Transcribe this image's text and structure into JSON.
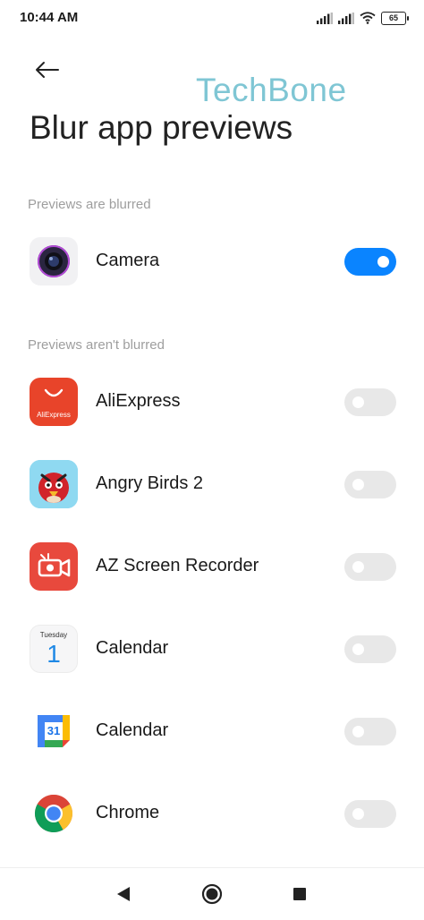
{
  "status_bar": {
    "time": "10:44 AM",
    "battery": "65",
    "icons": [
      "signal-icon",
      "signal-icon",
      "wifi-icon",
      "battery-icon"
    ]
  },
  "watermark": "TechBone",
  "header": {
    "back_icon": "back-arrow-icon",
    "title": "Blur app previews"
  },
  "sections": {
    "blurred": {
      "label": "Previews are blurred",
      "apps": [
        {
          "name": "Camera",
          "icon": "camera-icon",
          "enabled": true
        }
      ]
    },
    "not_blurred": {
      "label": "Previews aren't blurred",
      "apps": [
        {
          "name": "AliExpress",
          "icon": "aliexpress-icon",
          "icon_text": "AliExpress",
          "enabled": false
        },
        {
          "name": "Angry Birds 2",
          "icon": "angry-birds-icon",
          "enabled": false
        },
        {
          "name": "AZ Screen Recorder",
          "icon": "az-recorder-icon",
          "enabled": false
        },
        {
          "name": "Calendar",
          "icon": "calendar-icon",
          "icon_day": "Tuesday",
          "icon_date": "1",
          "enabled": false
        },
        {
          "name": "Calendar",
          "icon": "google-calendar-icon",
          "icon_date": "31",
          "enabled": false
        },
        {
          "name": "Chrome",
          "icon": "chrome-icon",
          "enabled": false
        }
      ]
    }
  },
  "navigation": {
    "back": "back-triangle-icon",
    "home": "home-circle-icon",
    "recents": "recents-square-icon"
  },
  "colors": {
    "accent": "#0a84ff",
    "toggle_off": "#e8e8e8",
    "section_label": "#9e9e9e",
    "watermark": "#7fc6d4",
    "aliexpress": "#e8442a",
    "az_recorder": "#e8493d"
  }
}
